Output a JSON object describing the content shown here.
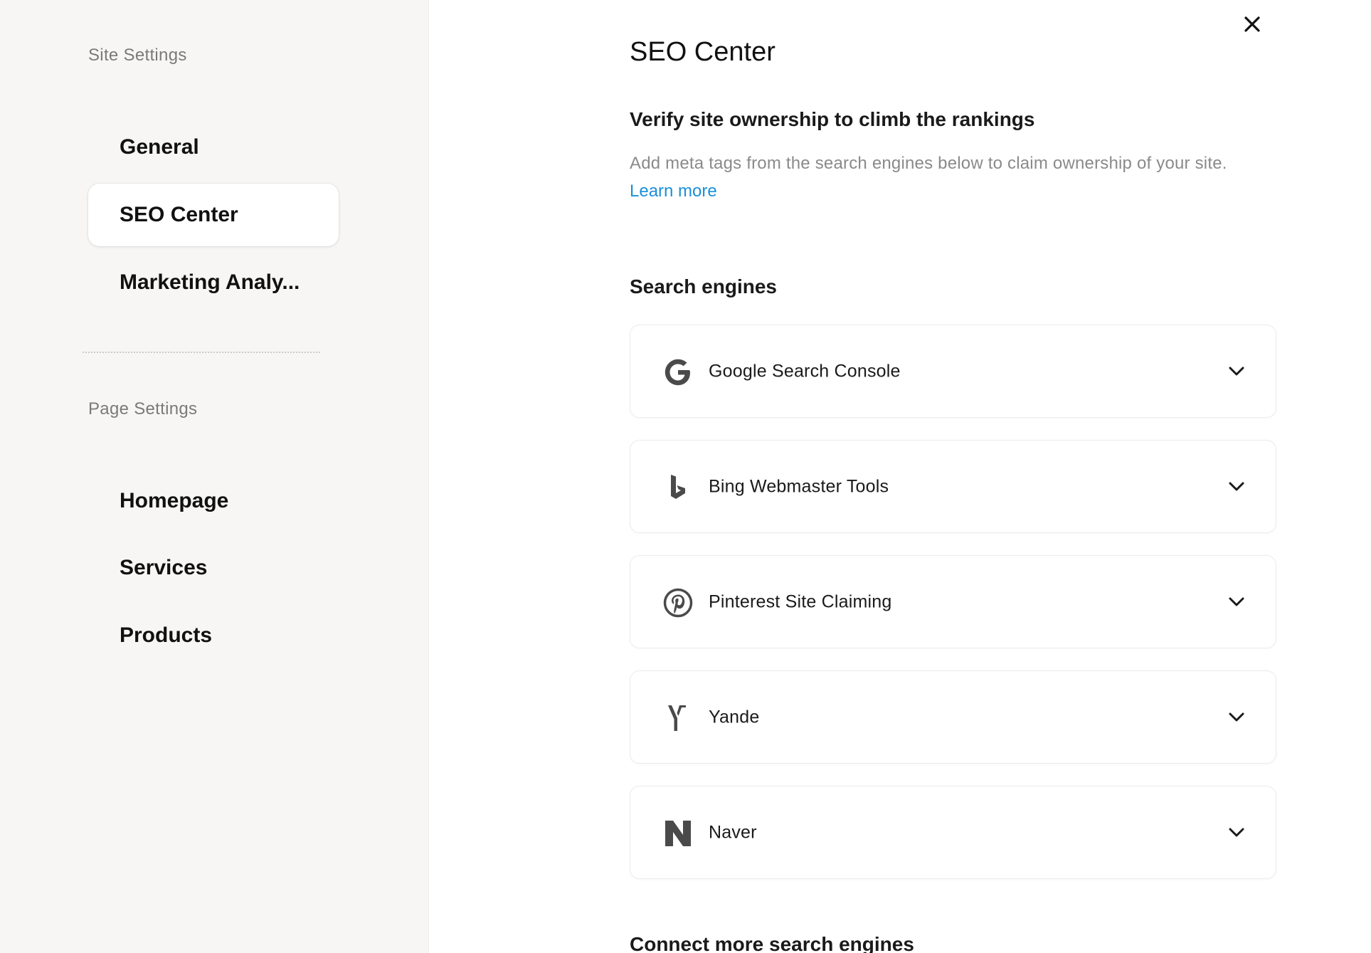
{
  "sidebar": {
    "site_settings_heading": "Site Settings",
    "site_items": [
      {
        "label": "General",
        "active": false
      },
      {
        "label": "SEO Center",
        "active": true
      },
      {
        "label": "Marketing Analy..."
      }
    ],
    "page_settings_heading": "Page Settings",
    "page_items": [
      {
        "label": "Homepage"
      },
      {
        "label": "Services"
      },
      {
        "label": "Products"
      }
    ]
  },
  "main": {
    "title": "SEO Center",
    "close_icon": "close-icon",
    "subtitle": "Verify site ownership to climb the rankings",
    "description": "Add meta tags from the search engines below to claim ownership of your site.",
    "learn_more": "Learn more",
    "search_engines_heading": "Search engines",
    "engines": [
      {
        "name": "Google Search Console",
        "icon": "google-icon"
      },
      {
        "name": "Bing Webmaster Tools",
        "icon": "bing-icon"
      },
      {
        "name": "Pinterest Site Claiming",
        "icon": "pinterest-icon"
      },
      {
        "name": "Yande",
        "icon": "yandex-icon"
      },
      {
        "name": "Naver",
        "icon": "naver-icon"
      }
    ],
    "connect_more_heading": "Connect more search engines"
  },
  "colors": {
    "sidebar_bg": "#f7f6f4",
    "link": "#1a90d9",
    "icon": "#4a4a4a"
  }
}
